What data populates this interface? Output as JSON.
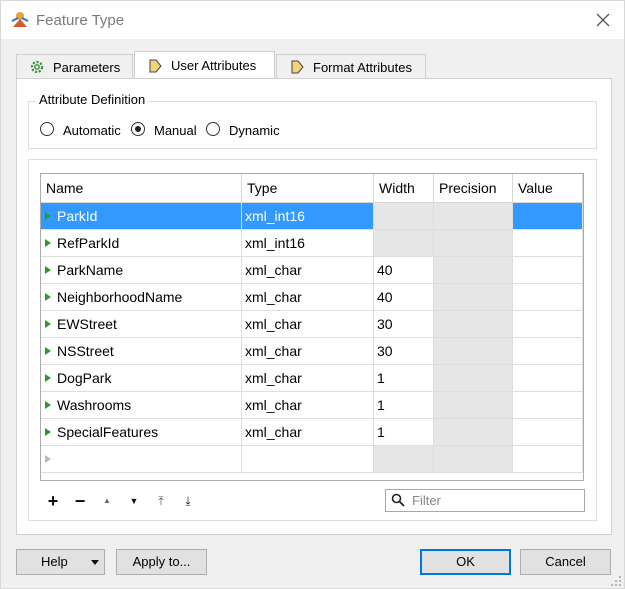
{
  "window": {
    "title": "Feature Type"
  },
  "tabs": [
    {
      "label": "Parameters",
      "icon": "gear-icon"
    },
    {
      "label": "User Attributes",
      "icon": "attribute-arrow-icon"
    },
    {
      "label": "Format Attributes",
      "icon": "attribute-arrow-icon"
    }
  ],
  "attribute_definition": {
    "title": "Attribute Definition",
    "options": [
      "Automatic",
      "Manual",
      "Dynamic"
    ],
    "selected": "Manual"
  },
  "table": {
    "columns": [
      "Name",
      "Type",
      "Width",
      "Precision",
      "Value"
    ],
    "rows": [
      {
        "name": "ParkId",
        "type": "xml_int16",
        "width": "",
        "precision": "",
        "value": ""
      },
      {
        "name": "RefParkId",
        "type": "xml_int16",
        "width": "",
        "precision": "",
        "value": ""
      },
      {
        "name": "ParkName",
        "type": "xml_char",
        "width": "40",
        "precision": "",
        "value": ""
      },
      {
        "name": "NeighborhoodName",
        "type": "xml_char",
        "width": "40",
        "precision": "",
        "value": ""
      },
      {
        "name": "EWStreet",
        "type": "xml_char",
        "width": "30",
        "precision": "",
        "value": ""
      },
      {
        "name": "NSStreet",
        "type": "xml_char",
        "width": "30",
        "precision": "",
        "value": ""
      },
      {
        "name": "DogPark",
        "type": "xml_char",
        "width": "1",
        "precision": "",
        "value": ""
      },
      {
        "name": "Washrooms",
        "type": "xml_char",
        "width": "1",
        "precision": "",
        "value": ""
      },
      {
        "name": "SpecialFeatures",
        "type": "xml_char",
        "width": "1",
        "precision": "",
        "value": ""
      }
    ],
    "selected_row": 0
  },
  "toolbar": {
    "add": "+",
    "remove": "−",
    "move_up": "▲",
    "move_down": "▼",
    "move_top": "⤒",
    "move_bottom": "⤓"
  },
  "filter": {
    "placeholder": "Filter"
  },
  "buttons": {
    "help": "Help",
    "apply_to": "Apply to...",
    "ok": "OK",
    "cancel": "Cancel"
  },
  "colors": {
    "selection": "#3399ff",
    "accent": "#0078d7",
    "row_marker": "#2a9a2a",
    "disabled_cell": "#e6e6e6"
  }
}
